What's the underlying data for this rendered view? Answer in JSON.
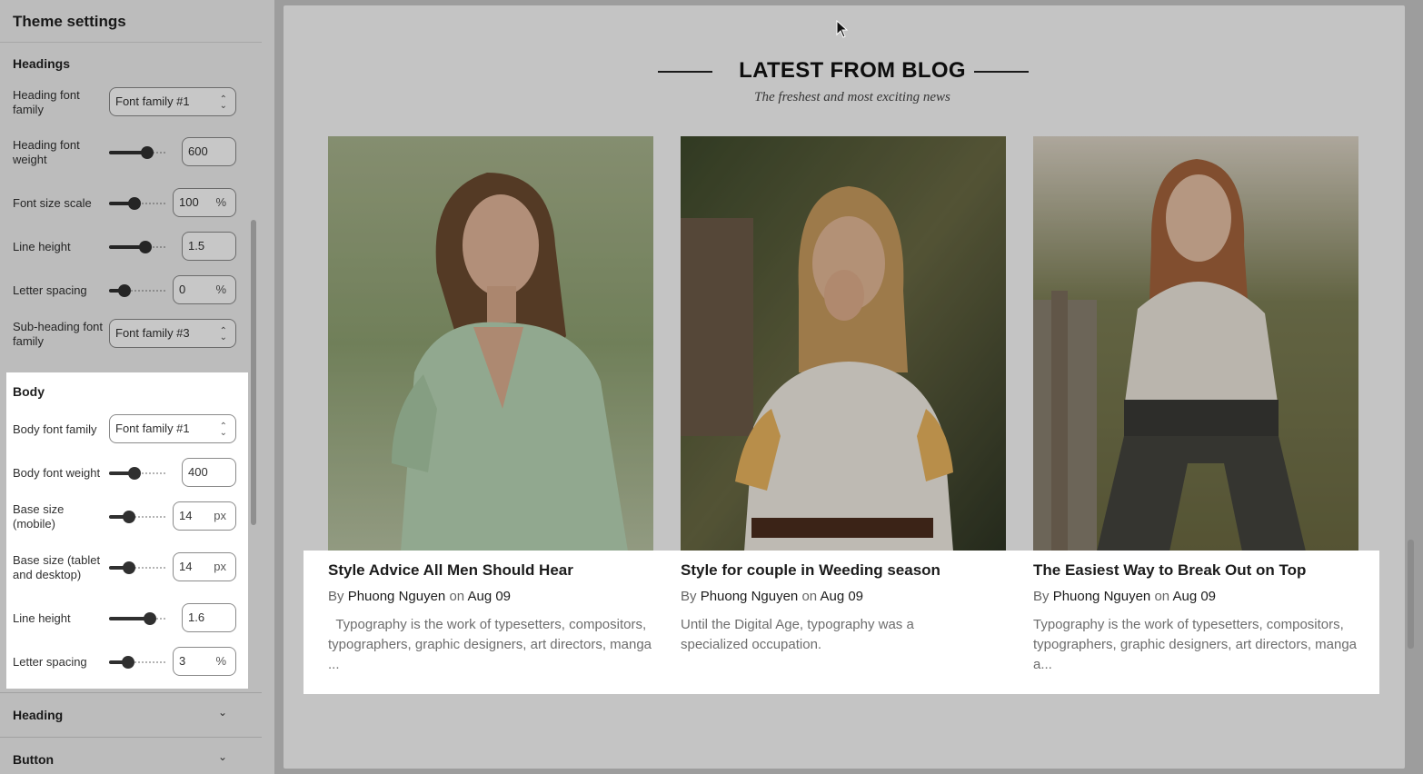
{
  "sidebar": {
    "title": "Theme settings",
    "headings_section": {
      "title": "Headings",
      "heading_font_family": {
        "label": "Heading font family",
        "value": "Font family #1"
      },
      "heading_font_weight": {
        "label": "Heading font weight",
        "value": "600",
        "slider_level": 0.68
      },
      "font_size_scale": {
        "label": "Font size scale",
        "value": "100",
        "unit": "%",
        "slider_level": 0.45
      },
      "line_height": {
        "label": "Line height",
        "value": "1.5",
        "slider_level": 0.65
      },
      "letter_spacing": {
        "label": "Letter spacing",
        "value": "0",
        "unit": "%",
        "slider_level": 0.27
      },
      "subheading_font_family": {
        "label": "Sub-heading font family",
        "value": "Font family #3"
      }
    },
    "body_section": {
      "title": "Body",
      "body_font_family": {
        "label": "Body font family",
        "value": "Font family #1"
      },
      "body_font_weight": {
        "label": "Body font weight",
        "value": "400",
        "slider_level": 0.45
      },
      "base_size_mobile": {
        "label": "Base size (mobile)",
        "value": "14",
        "unit": "px",
        "slider_level": 0.35
      },
      "base_size_desktop": {
        "label": "Base size (tablet and desktop)",
        "value": "14",
        "unit": "px",
        "slider_level": 0.35
      },
      "line_height": {
        "label": "Line height",
        "value": "1.6",
        "slider_level": 0.72
      },
      "letter_spacing": {
        "label": "Letter spacing",
        "value": "3",
        "unit": "%",
        "slider_level": 0.34
      }
    },
    "collapsed_sections": [
      {
        "label": "Heading"
      },
      {
        "label": "Button"
      }
    ]
  },
  "preview": {
    "blog_title": "LATEST FROM BLOG",
    "blog_subtitle": "The freshest and most exciting news",
    "posts": [
      {
        "title": "Style Advice All Men Should Hear",
        "by": "By",
        "author": "Phuong Nguyen",
        "on": "on",
        "date": "Aug 09",
        "excerpt": "  Typography is the work of typesetters, compositors, typographers, graphic designers, art directors, manga ..."
      },
      {
        "title": "Style for couple in Weeding season",
        "by": "By",
        "author": "Phuong Nguyen",
        "on": "on",
        "date": "Aug 09",
        "excerpt": "Until the Digital Age, typography was a specialized occupation."
      },
      {
        "title": "The Easiest Way to Break Out on Top",
        "by": "By",
        "author": "Phuong Nguyen",
        "on": "on",
        "date": "Aug 09",
        "excerpt": "Typography is the work of typesetters, compositors, typographers, graphic designers, art directors, manga a..."
      }
    ]
  },
  "icons": {
    "select_chevron": "select-updown-icon",
    "collapse_chevron": "chevron-down-icon",
    "cursor": "mouse-pointer-icon"
  }
}
